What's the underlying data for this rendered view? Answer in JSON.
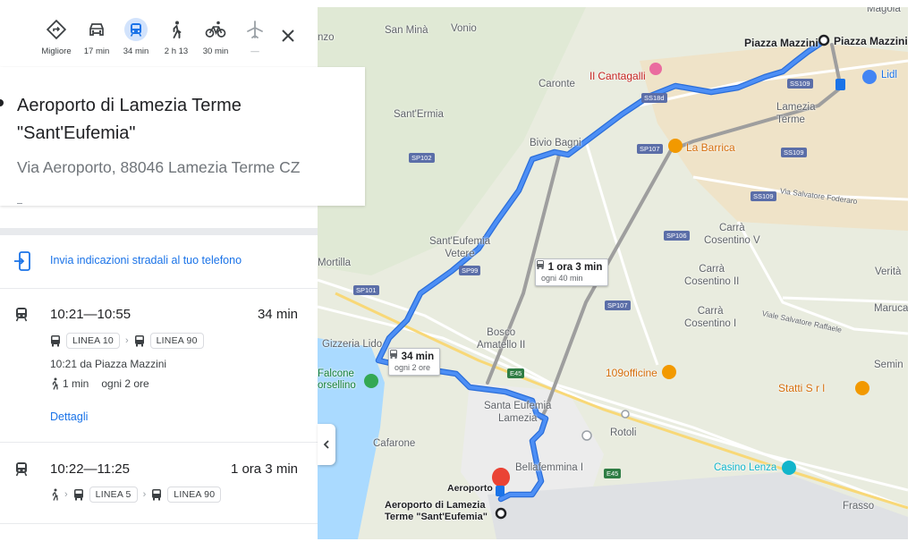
{
  "modes": [
    {
      "label": "Migliore",
      "icon": "best-route-icon",
      "selected": false
    },
    {
      "label": "17 min",
      "icon": "car-icon",
      "selected": false
    },
    {
      "label": "34 min",
      "icon": "train-icon",
      "selected": true
    },
    {
      "label": "2 h 13",
      "icon": "walk-icon",
      "selected": false
    },
    {
      "label": "30 min",
      "icon": "bicycle-icon",
      "selected": false
    },
    {
      "label": "—",
      "icon": "flight-icon",
      "selected": false
    }
  ],
  "destination": {
    "name": "Aeroporto di Lamezia Terme \"Sant'Eufemia\"",
    "address": "Via Aeroporto, 88046 Lamezia Terme CZ"
  },
  "send_to_phone": "Invia indicazioni stradali al tuo telefono",
  "routes": [
    {
      "time_range": "10:21—10:55",
      "duration": "34 min",
      "lines": [
        "LINEA 10",
        "LINEA 90"
      ],
      "departure": "10:21 da Piazza Mazzini",
      "walk": "1 min",
      "frequency": "ogni 2 ore",
      "details_link": "Dettagli"
    },
    {
      "time_range": "10:22—11:25",
      "duration": "1 ora 3 min",
      "lines": [
        "LINEA 5",
        "LINEA 90"
      ]
    }
  ],
  "map": {
    "labels": {
      "piazza_mazzini_a": "Piazza Mazzini",
      "piazza_mazzini_b": "Piazza Mazzini",
      "magola": "Magola",
      "san_mina": "San Minà",
      "vonio": "Vonio",
      "nzo": "nzo",
      "caronte": "Caronte",
      "cantagalli": "Il Cantagalli",
      "lidl": "Lidl",
      "lamezia_terme": "Lamezia\nTerme",
      "sant_ermia": "Sant'Ermia",
      "bivio_bagni": "Bivio Bagni",
      "la_barrica": "La Barrica",
      "via_salvatore_foderaro": "Via Salvatore Foderaro",
      "santeufemia_vetere": "Sant'Eufemia\nVetere",
      "carra_cosentino_v": "Carrà\nCosentino V",
      "mortilla": "Mortilla",
      "verita": "Verità",
      "carra_cosentino_ii": "Carrà\nCosentino II",
      "maruca": "Maruca",
      "carra_cosentino_i": "Carrà\nCosentino I",
      "viale_salvatore_raffaele": "Viale Salvatore Raffaele",
      "gizzeria_lido": "Gizzeria Lido",
      "bosco_amatello": "Bosco\nAmatello II",
      "falcone": "Falcone\norsellino",
      "officine": "109officine",
      "statti": "Statti S r l",
      "semin": "Semin",
      "santa_eufemia_lamezia": "Santa Eufemia\nLamezia",
      "cafarone": "Cafarone",
      "rotoli": "Rotoli",
      "bellafemmina": "Bellafemmina I",
      "casino_lenza": "Casino Lenza",
      "aeroporto": "Aeroporto",
      "aeroporto_dest": "Aeroporto di Lamezia\nTerme \"Sant'Eufemia\"",
      "frasso": "Frasso"
    },
    "road_signs": {
      "ss18d": "SS18d",
      "ss109a": "SS109",
      "ss109b": "SS109",
      "ss109c": "SS109",
      "sp102": "SP102",
      "sp107a": "SP107",
      "sp106": "SP106",
      "sp99": "SP99",
      "sp101": "SP101",
      "sp107b": "SP107",
      "e45a": "E45",
      "e45b": "E45"
    },
    "route_boxes": [
      {
        "duration": "1 ora 3 min",
        "frequency": "ogni 40 min"
      },
      {
        "duration": "34 min",
        "frequency": "ogni 2 ore"
      }
    ],
    "colors": {
      "route_primary": "#4285f4",
      "route_alt": "#9e9e9e",
      "urban": "#efe3c8",
      "sea": "#aadaff"
    }
  }
}
